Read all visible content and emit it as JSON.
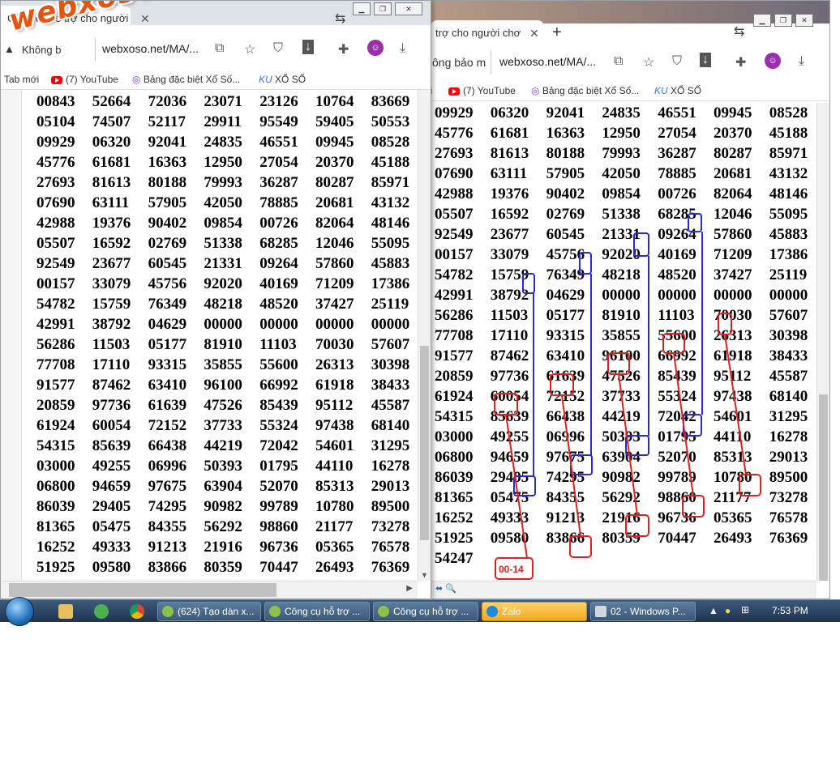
{
  "watermark": "webxoso.net",
  "right_window": {
    "tab_title": "trợ cho người chơ",
    "new_tab": "+",
    "url_prefix": "ông bảo m",
    "url": "webxoso.net/MA/...",
    "bookmarks": [
      {
        "label": "(7) YouTube"
      },
      {
        "label": "Bảng đặc biệt Xổ Số..."
      },
      {
        "label": "XỔ SỐ"
      }
    ],
    "rows": [
      [
        "09929",
        "06320",
        "92041",
        "24835",
        "46551",
        "09945",
        "08528"
      ],
      [
        "45776",
        "61681",
        "16363",
        "12950",
        "27054",
        "20370",
        "45188"
      ],
      [
        "27693",
        "81613",
        "80188",
        "79993",
        "36287",
        "80287",
        "85971"
      ],
      [
        "07690",
        "63111",
        "57905",
        "42050",
        "78885",
        "20681",
        "43132"
      ],
      [
        "42988",
        "19376",
        "90402",
        "09854",
        "00726",
        "82064",
        "48146"
      ],
      [
        "05507",
        "16592",
        "02769",
        "51338",
        "68285",
        "12046",
        "55095"
      ],
      [
        "92549",
        "23677",
        "60545",
        "21331",
        "09264",
        "57860",
        "45883"
      ],
      [
        "00157",
        "33079",
        "45756",
        "92020",
        "40169",
        "71209",
        "17386"
      ],
      [
        "54782",
        "15759",
        "76349",
        "48218",
        "48520",
        "37427",
        "25119"
      ],
      [
        "42991",
        "38792",
        "04629",
        "00000",
        "00000",
        "00000",
        "00000"
      ],
      [
        "56286",
        "11503",
        "05177",
        "81910",
        "11103",
        "70030",
        "57607"
      ],
      [
        "77708",
        "17110",
        "93315",
        "35855",
        "55600",
        "26313",
        "30398"
      ],
      [
        "91577",
        "87462",
        "63410",
        "96100",
        "66992",
        "61918",
        "38433"
      ],
      [
        "20859",
        "97736",
        "61639",
        "47526",
        "85439",
        "95112",
        "45587"
      ],
      [
        "61924",
        "60054",
        "72152",
        "37733",
        "55324",
        "97438",
        "68140"
      ],
      [
        "54315",
        "85639",
        "66438",
        "44219",
        "72042",
        "54601",
        "31295"
      ],
      [
        "03000",
        "49255",
        "06996",
        "50393",
        "01795",
        "44110",
        "16278"
      ],
      [
        "06800",
        "94659",
        "97675",
        "63904",
        "52070",
        "85313",
        "29013"
      ],
      [
        "86039",
        "29405",
        "74295",
        "90982",
        "99789",
        "10780",
        "89500"
      ],
      [
        "81365",
        "05475",
        "84355",
        "56292",
        "98860",
        "21177",
        "73278"
      ],
      [
        "16252",
        "49333",
        "91213",
        "21916",
        "96736",
        "05365",
        "76578"
      ],
      [
        "51925",
        "09580",
        "83866",
        "80359",
        "70447",
        "26493",
        "76369"
      ],
      [
        "54247",
        "",
        "",
        "",
        "",
        "",
        ""
      ]
    ],
    "annotation_label": "00-14"
  },
  "left_window": {
    "tab_title": "Công cụ hỗ trợ cho người chơ",
    "url_prefix": "Không b",
    "url": "webxoso.net/MA/...",
    "bookmarks": [
      {
        "label": "Tab mới"
      },
      {
        "label": "(7) YouTube"
      },
      {
        "label": "Bảng đặc biệt Xổ Số..."
      },
      {
        "label": "XỔ SỐ"
      }
    ],
    "rows": [
      [
        "00843",
        "52664",
        "72036",
        "23071",
        "23126",
        "10764",
        "83669"
      ],
      [
        "05104",
        "74507",
        "52117",
        "29911",
        "95549",
        "59405",
        "50553"
      ],
      [
        "09929",
        "06320",
        "92041",
        "24835",
        "46551",
        "09945",
        "08528"
      ],
      [
        "45776",
        "61681",
        "16363",
        "12950",
        "27054",
        "20370",
        "45188"
      ],
      [
        "27693",
        "81613",
        "80188",
        "79993",
        "36287",
        "80287",
        "85971"
      ],
      [
        "07690",
        "63111",
        "57905",
        "42050",
        "78885",
        "20681",
        "43132"
      ],
      [
        "42988",
        "19376",
        "90402",
        "09854",
        "00726",
        "82064",
        "48146"
      ],
      [
        "05507",
        "16592",
        "02769",
        "51338",
        "68285",
        "12046",
        "55095"
      ],
      [
        "92549",
        "23677",
        "60545",
        "21331",
        "09264",
        "57860",
        "45883"
      ],
      [
        "00157",
        "33079",
        "45756",
        "92020",
        "40169",
        "71209",
        "17386"
      ],
      [
        "54782",
        "15759",
        "76349",
        "48218",
        "48520",
        "37427",
        "25119"
      ],
      [
        "42991",
        "38792",
        "04629",
        "00000",
        "00000",
        "00000",
        "00000"
      ],
      [
        "56286",
        "11503",
        "05177",
        "81910",
        "11103",
        "70030",
        "57607"
      ],
      [
        "77708",
        "17110",
        "93315",
        "35855",
        "55600",
        "26313",
        "30398"
      ],
      [
        "91577",
        "87462",
        "63410",
        "96100",
        "66992",
        "61918",
        "38433"
      ],
      [
        "20859",
        "97736",
        "61639",
        "47526",
        "85439",
        "95112",
        "45587"
      ],
      [
        "61924",
        "60054",
        "72152",
        "37733",
        "55324",
        "97438",
        "68140"
      ],
      [
        "54315",
        "85639",
        "66438",
        "44219",
        "72042",
        "54601",
        "31295"
      ],
      [
        "03000",
        "49255",
        "06996",
        "50393",
        "01795",
        "44110",
        "16278"
      ],
      [
        "06800",
        "94659",
        "97675",
        "63904",
        "52070",
        "85313",
        "29013"
      ],
      [
        "86039",
        "29405",
        "74295",
        "90982",
        "99789",
        "10780",
        "89500"
      ],
      [
        "81365",
        "05475",
        "84355",
        "56292",
        "98860",
        "21177",
        "73278"
      ],
      [
        "16252",
        "49333",
        "91213",
        "21916",
        "96736",
        "05365",
        "76578"
      ],
      [
        "51925",
        "09580",
        "83866",
        "80359",
        "70447",
        "26493",
        "76369"
      ]
    ]
  },
  "taskbar": {
    "tasks": [
      {
        "label": "(624) Tạo dàn x..."
      },
      {
        "label": "Công cụ hỗ trợ ..."
      },
      {
        "label": "Công cụ hỗ trợ ..."
      },
      {
        "label": "Zalo"
      },
      {
        "label": "02 - Windows P..."
      }
    ],
    "clock": "7:53 PM"
  },
  "colors": {
    "annotation_red": "#e0201c",
    "annotation_blue": "#2a2ad0",
    "taskbar": "#2b4566"
  }
}
